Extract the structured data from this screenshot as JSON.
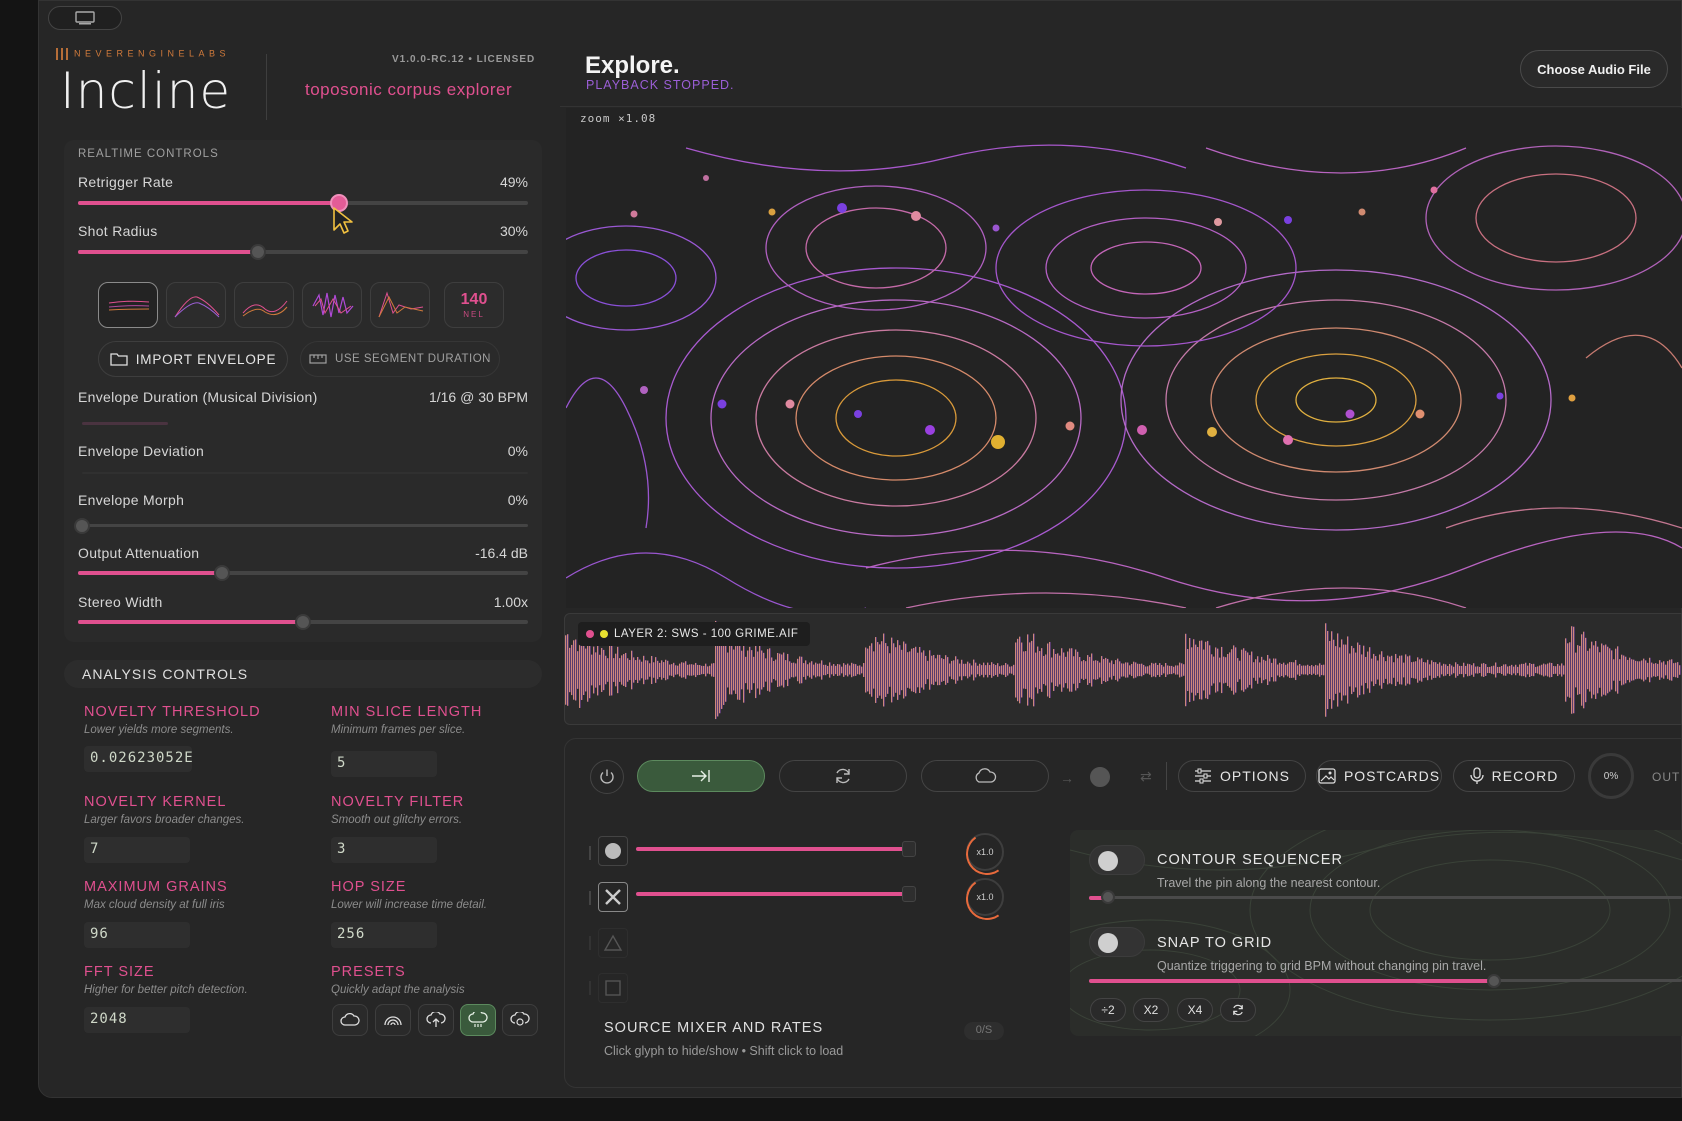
{
  "app": {
    "brand": "NEVERENGINELABS",
    "title": "Incline",
    "version": "V1.0.0-RC.12 • LICENSED",
    "subtitle": "toposonic corpus explorer"
  },
  "realtime": {
    "section_label": "REALTIME CONTROLS",
    "controls": [
      {
        "label": "Retrigger Rate",
        "value": "49%",
        "level": 0.58
      },
      {
        "label": "Shot Radius",
        "value": "30%",
        "level": 0.4
      },
      {
        "label": "Envelope Duration (Musical Division)",
        "value": "1/16 @ 30 BPM"
      },
      {
        "label": "Envelope Deviation",
        "value": "0%"
      },
      {
        "label": "Envelope Morph",
        "value": "0%",
        "level": 0.0
      },
      {
        "label": "Output Attenuation",
        "value": "-16.4 dB",
        "level": 0.32
      },
      {
        "label": "Stereo Width",
        "value": "1.00x",
        "level": 0.5
      }
    ],
    "envelope_count": "140",
    "envelope_count_unit": "NEL",
    "import_envelope": "IMPORT ENVELOPE",
    "use_segment_duration": "USE SEGMENT DURATION"
  },
  "analysis": {
    "section_label": "ANALYSIS CONTROLS",
    "fields": [
      {
        "title": "NOVELTY THRESHOLD",
        "desc": "Lower yields more segments.",
        "value": "0.02623052E"
      },
      {
        "title": "MIN SLICE LENGTH",
        "desc": "Minimum frames per slice.",
        "value": "5"
      },
      {
        "title": "NOVELTY KERNEL",
        "desc": "Larger favors broader changes.",
        "value": "7"
      },
      {
        "title": "NOVELTY FILTER",
        "desc": "Smooth out glitchy errors.",
        "value": "3"
      },
      {
        "title": "MAXIMUM GRAINS",
        "desc": "Max cloud density at full iris",
        "value": "96"
      },
      {
        "title": "HOP SIZE",
        "desc": "Lower will increase time detail.",
        "value": "256"
      },
      {
        "title": "FFT SIZE",
        "desc": "Higher for better pitch detection.",
        "value": "2048"
      },
      {
        "title": "PRESETS",
        "desc": "Quickly adapt the analysis",
        "value": ""
      }
    ],
    "presets": [
      "cloud-icon",
      "rainbow-icon",
      "cloud-upload-icon",
      "cloud-rain-icon",
      "cloud-sync-icon"
    ]
  },
  "explore": {
    "title": "Explore.",
    "status": "PLAYBACK STOPPED.",
    "choose_file": "Choose Audio File",
    "zoom": "zoom  ×1.08"
  },
  "waveform": {
    "layer_label": "LAYER 2: SWS - 100 GRIME.AIF"
  },
  "transport": {
    "options": "OPTIONS",
    "postcards": "POSTCARDS",
    "record": "RECORD",
    "progress": "0%",
    "out": "OUT"
  },
  "source_mixer": {
    "title": "SOURCE MIXER AND RATES",
    "desc": "Click glyph to hide/show • Shift click to load",
    "counter": "0/S",
    "rate_1": "x1.0",
    "rate_2": "x1.0"
  },
  "sequencer": {
    "contour_title": "CONTOUR SEQUENCER",
    "contour_desc": "Travel the pin along the nearest contour.",
    "snap_title": "SNAP TO GRID",
    "snap_desc": "Quantize triggering to grid BPM without changing pin travel.",
    "multipliers": [
      "÷2",
      "X2",
      "X4"
    ]
  },
  "colors": {
    "accent": "#e0508f",
    "purple": "#9b5ed6",
    "green": "#3a5a3c",
    "amber": "#c9a832"
  }
}
